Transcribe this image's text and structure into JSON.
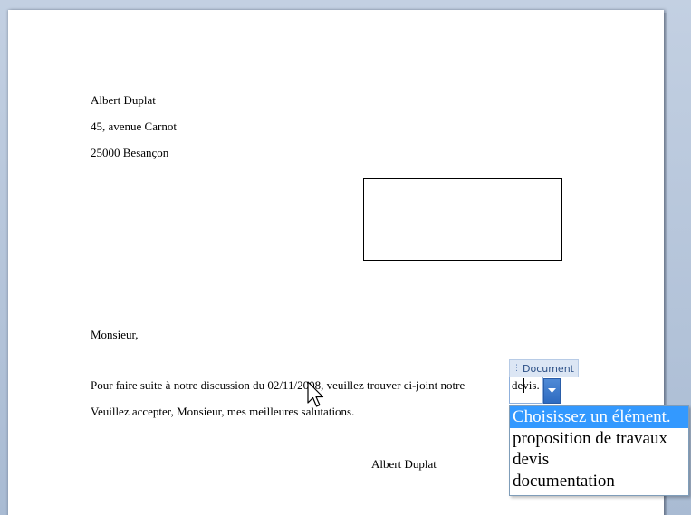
{
  "document": {
    "sender": {
      "name": "Albert Duplat",
      "street": "45, avenue Carnot",
      "city": "25000 Besançon"
    },
    "salutation": "Monsieur,",
    "body_line1_prefix": "Pour faire suite à notre discussion du 02/11/2008, veuillez trouver ci-joint notre",
    "body_line2": "Veuillez accepter, Monsieur, mes meilleures salutations.",
    "signature": "Albert Duplat"
  },
  "content_control": {
    "title": "Document",
    "value": "devis.",
    "dropdown_options": [
      "Choisissez un élément.",
      "proposition de travaux",
      "devis",
      "documentation"
    ],
    "selected_option": "Choisissez un élément."
  },
  "colors": {
    "background": "#aebfd6",
    "page": "#ffffff",
    "selection": "#3399ff",
    "control_tab": "#dce6f4",
    "dropdown_button": "#2e6bc0"
  },
  "icons": {
    "grip": "grip-dots-icon",
    "dropdown": "dropdown-arrow-icon",
    "cursor": "mouse-pointer-icon"
  }
}
